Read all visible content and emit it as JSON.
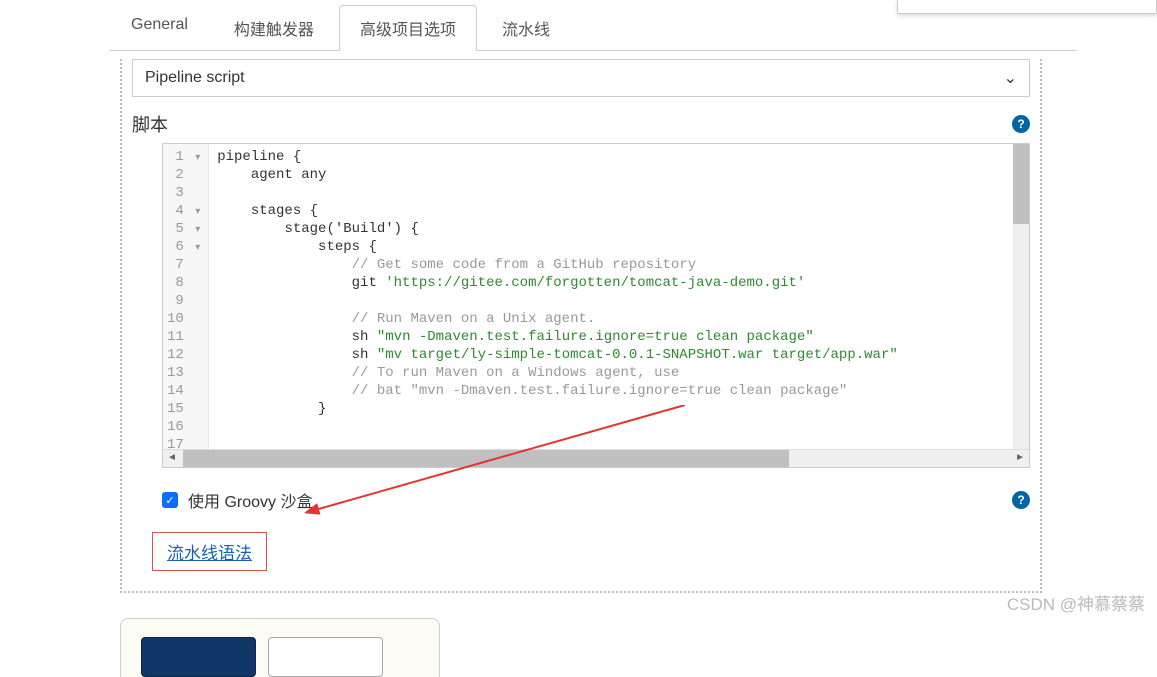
{
  "tabs": {
    "general": "General",
    "triggers": "构建触发器",
    "advanced": "高级项目选项",
    "pipeline": "流水线"
  },
  "definition": {
    "selected": "Pipeline script"
  },
  "script": {
    "label": "脚本",
    "lines": [
      {
        "n": 1,
        "fold": true,
        "indent": "",
        "text": "pipeline {"
      },
      {
        "n": 2,
        "fold": false,
        "indent": "    ",
        "text": "agent any"
      },
      {
        "n": 3,
        "fold": false,
        "indent": "",
        "text": ""
      },
      {
        "n": 4,
        "fold": true,
        "indent": "    ",
        "text": "stages {"
      },
      {
        "n": 5,
        "fold": true,
        "indent": "        ",
        "text": "stage('Build') {"
      },
      {
        "n": 6,
        "fold": true,
        "indent": "            ",
        "text": "steps {"
      },
      {
        "n": 7,
        "fold": false,
        "indent": "                ",
        "cmt": "// Get some code from a GitHub repository"
      },
      {
        "n": 8,
        "fold": false,
        "indent": "                ",
        "text": "git ",
        "str": "'https://gitee.com/forgotten/tomcat-java-demo.git'"
      },
      {
        "n": 9,
        "fold": false,
        "indent": "",
        "text": ""
      },
      {
        "n": 10,
        "fold": false,
        "indent": "                ",
        "cmt": "// Run Maven on a Unix agent."
      },
      {
        "n": 11,
        "fold": false,
        "indent": "                ",
        "text": "sh ",
        "str": "\"mvn -Dmaven.test.failure.ignore=true clean package\""
      },
      {
        "n": 12,
        "fold": false,
        "indent": "                ",
        "text": "sh ",
        "str": "\"mv target/ly-simple-tomcat-0.0.1-SNAPSHOT.war target/app.war\""
      },
      {
        "n": 13,
        "fold": false,
        "indent": "                ",
        "cmt": "// To run Maven on a Windows agent, use"
      },
      {
        "n": 14,
        "fold": false,
        "indent": "                ",
        "cmt": "// bat \"mvn -Dmaven.test.failure.ignore=true clean package\""
      },
      {
        "n": 15,
        "fold": false,
        "indent": "            ",
        "text": "}"
      },
      {
        "n": 16,
        "fold": false,
        "indent": "",
        "text": ""
      },
      {
        "n": 17,
        "fold": false,
        "indent": "",
        "text": ""
      }
    ]
  },
  "sandbox": {
    "checked": true,
    "label": "使用 Groovy 沙盒"
  },
  "syntax_link": "流水线语法",
  "watermark": "CSDN @神慕蔡蔡"
}
